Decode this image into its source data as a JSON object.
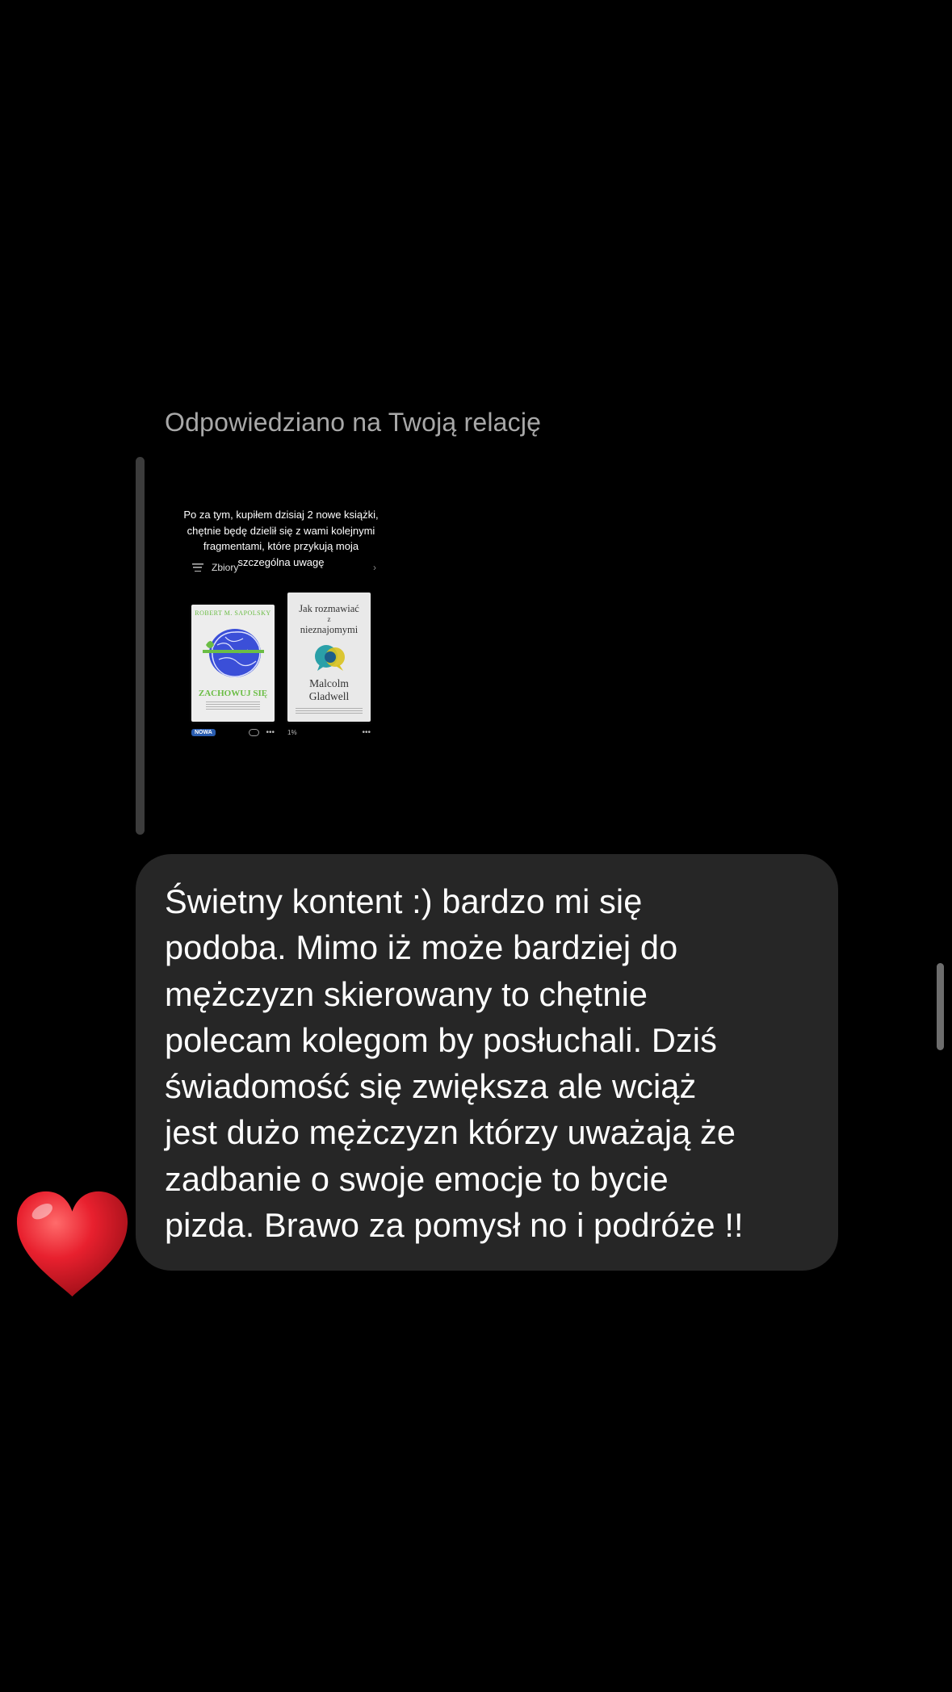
{
  "reply": {
    "label": "Odpowiedziano na Twoją relację"
  },
  "story": {
    "caption": "Po za tym, kupiłem dzisiaj 2 nowe książki, chętnie będę dzielił się z wami kolejnymi fragmentami, które przykują moja szczególna uwagę",
    "collection_label": "Zbiory",
    "books": [
      {
        "author": "ROBERT M. SAPOLSKY",
        "title": "ZACHOWUJ SIĘ",
        "badge": "NOWA"
      },
      {
        "title_line1": "Jak rozmawiać",
        "title_line2": "z",
        "title_line3": "nieznajomymi",
        "author_line1": "Malcolm",
        "author_line2": "Gladwell",
        "progress": "1%"
      }
    ]
  },
  "message": {
    "text": "Świetny kontent :) bardzo mi się\npodoba. Mimo iż może bardziej do\nmężczyzn skierowany to chętnie\npolecam kolegom by posłuchali. Dziś\nświadomość się zwiększa ale wciąż\njest dużo mężczyzn którzy uważają że\nzadbanie o swoje emocje to bycie\npizda. Brawo za pomysł no i podróże !!",
    "reaction": "heart"
  },
  "colors": {
    "background": "#000000",
    "bubble": "#262626",
    "label": "#a8a8a8",
    "heart": "#e8202e"
  }
}
